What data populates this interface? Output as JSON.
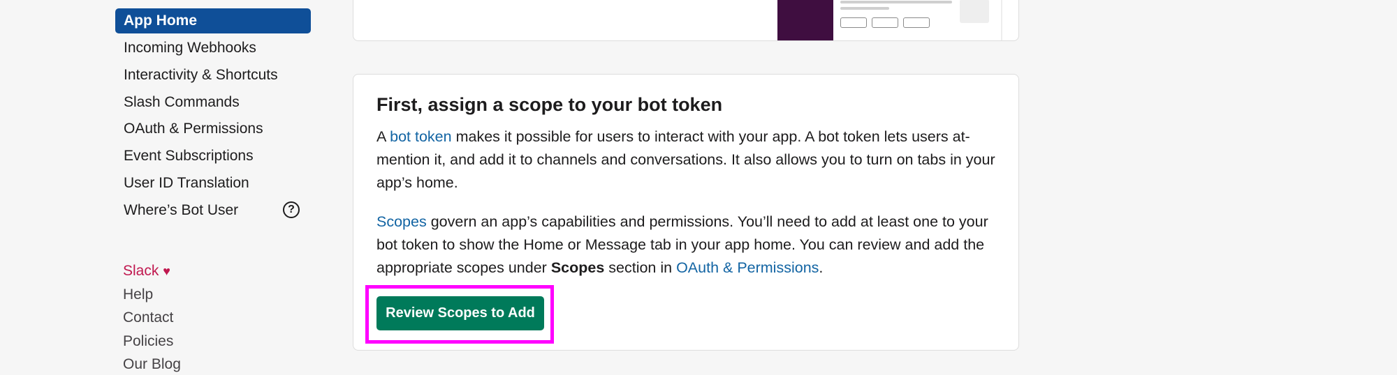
{
  "sidebar": {
    "items": [
      {
        "label": "App Home",
        "active": true
      },
      {
        "label": "Incoming Webhooks"
      },
      {
        "label": "Interactivity & Shortcuts"
      },
      {
        "label": "Slash Commands"
      },
      {
        "label": "OAuth & Permissions"
      },
      {
        "label": "Event Subscriptions"
      },
      {
        "label": "User ID Translation"
      },
      {
        "label": "Where’s Bot User",
        "help_icon": "question-circle-icon",
        "help_glyph": "?"
      }
    ],
    "footer": [
      {
        "label": "Slack",
        "icon": "heart-icon",
        "glyph": "♥"
      },
      {
        "label": "Help"
      },
      {
        "label": "Contact"
      },
      {
        "label": "Policies"
      },
      {
        "label": "Our Blog"
      }
    ]
  },
  "card": {
    "title": "First, assign a scope to your bot token",
    "p1": {
      "pre": "A ",
      "link": "bot token",
      "post": " makes it possible for users to interact with your app. A bot token lets users at-mention it, and add it to channels and conversations. It also allows you to turn on tabs in your app’s home."
    },
    "p2": {
      "link1": "Scopes",
      "text1": " govern an app’s capabilities and permissions. You’ll need to add at least one to your bot token to show the Home or Message tab in your app home. You can review and add the appropriate scopes under ",
      "bold": "Scopes",
      "text2": " section in ",
      "link2": "OAuth & Permissions",
      "text3": "."
    },
    "button_label": "Review Scopes to Add"
  },
  "colors": {
    "active_nav": "#0f4f98",
    "link": "#1264a3",
    "primary_button": "#007a5a",
    "highlight": "#ff00ff",
    "slack": "#c0184f",
    "preview_sidebar": "#3f0e40"
  }
}
